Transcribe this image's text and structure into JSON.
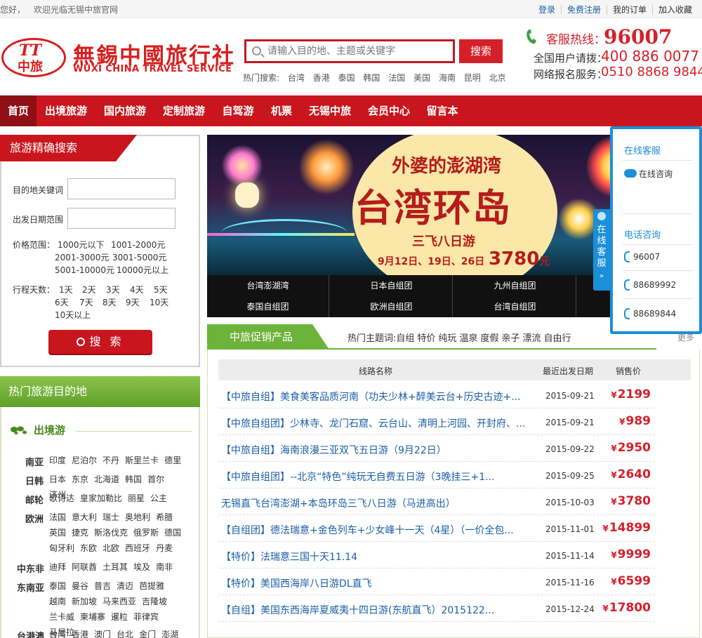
{
  "topbar": {
    "greeting": "您好，",
    "welcome": "欢迎光临无锡中旅官网",
    "links": [
      "登录",
      "免费注册",
      "我的订单",
      "加入收藏"
    ]
  },
  "logo": {
    "mark_top": "TT",
    "mark_bottom": "中旅",
    "name_cn": "無錫中國旅行社",
    "name_en": "WUXI CHINA TRAVEL SERVICE"
  },
  "search": {
    "placeholder": "请输入目的地、主题或关键字",
    "button": "搜索",
    "hot_label": "热门搜索:",
    "hot_keywords": [
      "台湾",
      "香港",
      "泰国",
      "韩国",
      "法国",
      "美国",
      "海南",
      "昆明",
      "北京"
    ]
  },
  "hotline": {
    "label1": "客服热线：",
    "num1": "96007",
    "label2": "全国用户请拨：",
    "num2": "400 886 0077",
    "label3": "网络报名服务：",
    "num3": "0510 8868 9844"
  },
  "nav": [
    "首页",
    "出境旅游",
    "国内旅游",
    "定制旅游",
    "自驾游",
    "机票",
    "无锡中旅",
    "会员中心",
    "留言本"
  ],
  "finder": {
    "title": "旅游精确搜索",
    "dest_label": "目的地关键词",
    "date_label": "出发日期范围",
    "price_label": "价格范围：",
    "prices": [
      "1000元以下",
      "1001-2000元",
      "2001-3000元",
      "3001-5000元",
      "5001-10000元",
      "10000元以上"
    ],
    "days_label": "行程天数：",
    "days": [
      "1天",
      "2天",
      "3天",
      "4天",
      "5天",
      "6天",
      "7天",
      "8天",
      "9天",
      "10天",
      "10天以上"
    ],
    "button": "搜 索"
  },
  "destinations": {
    "title": "热门旅游目的地",
    "subtitle": "出境游",
    "regions": [
      {
        "name": "南亚",
        "places": [
          "印度",
          "尼泊尔",
          "不丹",
          "斯里兰卡",
          "德里"
        ]
      },
      {
        "name": "日韩",
        "places": [
          "日本",
          "东京",
          "北海道",
          "韩国",
          "首尔",
          "济州"
        ]
      },
      {
        "name": "邮轮",
        "places": [
          "歌诗达",
          "皇家加勒比",
          "丽星",
          "公主"
        ]
      },
      {
        "name": "欧洲",
        "places": [
          "法国",
          "意大利",
          "瑞士",
          "奥地利",
          "希腊",
          "英国",
          "捷克",
          "斯洛伐克",
          "俄罗斯",
          "德国",
          "匈牙利",
          "东欧",
          "北欧",
          "西班牙",
          "丹麦"
        ]
      },
      {
        "name": "中东非",
        "places": [
          "迪拜",
          "阿联酋",
          "土耳其",
          "埃及",
          "南非"
        ]
      },
      {
        "name": "东南亚",
        "places": [
          "泰国",
          "曼谷",
          "普吉",
          "清迈",
          "芭提雅",
          "越南",
          "新加坡",
          "马来西亚",
          "吉隆坡",
          "兰卡威",
          "柬埔寨",
          "暹粒",
          "菲律宾",
          "马尼拉"
        ]
      },
      {
        "name": "台港澳",
        "places": [
          "台湾",
          "香港",
          "澳门",
          "台北",
          "金门",
          "澎湖"
        ]
      }
    ]
  },
  "banner": {
    "line1": "外婆的澎湖湾",
    "line2": "台湾环岛",
    "line3": "三飞八日游",
    "dates": "9月12日、19日、26日",
    "price": "3780",
    "price_unit": "元"
  },
  "banner_tabs": [
    "台湾澎湖湾",
    "日本自组团",
    "九州自组团",
    "泰国自组团",
    "欧洲自组团",
    "台湾自组团"
  ],
  "service": {
    "online_title": "在线客服",
    "online_item": "在线咨询",
    "phone_title": "电话咨询",
    "phones": [
      "96007",
      "88689992",
      "88689844"
    ],
    "side_label": "在线客服"
  },
  "promo": {
    "title": "中旅促销产品",
    "hot_label": "热门主题词:",
    "hot_words": [
      "自组",
      "特价",
      "纯玩",
      "温泉",
      "度假",
      "亲子",
      "漂流",
      "自由行"
    ],
    "more": "更多",
    "columns": [
      "线路名称",
      "最近出发日期",
      "销售价"
    ],
    "currency": "¥",
    "rows": [
      {
        "name": "【中旅自组】美食美客品质河南（功夫少林+醉美云台+历史古迹+...",
        "date": "2015-09-21",
        "price": "2199"
      },
      {
        "name": "【中旅自组团】少林寺、龙门石窟、云台山、清明上河园、开封府、...",
        "date": "2015-09-21",
        "price": "989"
      },
      {
        "name": "【中旅自组】海南浪漫三亚双飞五日游（9月22日）",
        "date": "2015-09-22",
        "price": "2950"
      },
      {
        "name": "【中旅自组团】--北京“特色”纯玩无自费五日游（3晚挂三+1...",
        "date": "2015-09-25",
        "price": "2640"
      },
      {
        "name": "无锡直飞台湾澎湖+本岛环岛三飞八日游（马进高出）",
        "date": "2015-10-03",
        "price": "3780"
      },
      {
        "name": "【自组团】德法瑞意+金色列车+少女峰十一天（4星）（一价全包...",
        "date": "2015-11-01",
        "price": "14899"
      },
      {
        "name": "【特价】法瑞意三国十天11.14",
        "date": "2015-11-14",
        "price": "9999"
      },
      {
        "name": "【特价】美国西海岸八日游DL直飞",
        "date": "2015-11-16",
        "price": "6599"
      },
      {
        "name": "【自组】美国东西海岸夏威夷十四日游(东航直飞）2015122...",
        "date": "2015-12-24",
        "price": "17800"
      }
    ]
  }
}
